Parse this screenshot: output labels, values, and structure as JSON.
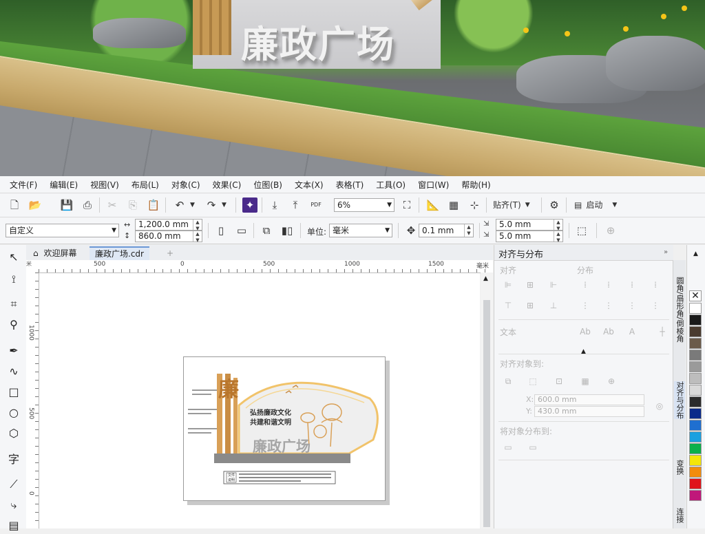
{
  "scene": {
    "sign_text": "廉政广场"
  },
  "menu": [
    "文件(F)",
    "编辑(E)",
    "视图(V)",
    "布局(L)",
    "对象(C)",
    "效果(C)",
    "位图(B)",
    "文本(X)",
    "表格(T)",
    "工具(O)",
    "窗口(W)",
    "帮助(H)"
  ],
  "toolbar": {
    "zoom": "6%",
    "snap_label": "贴齐(T)",
    "launch_label": "启动",
    "pdf_label": "PDF"
  },
  "props": {
    "paper_preset": "自定义",
    "width": "1,200.0 mm",
    "height": "860.0 mm",
    "units_label": "单位:",
    "units_value": "毫米",
    "nudge": "0.1 mm",
    "dup_x": "5.0 mm",
    "dup_y": "5.0 mm"
  },
  "tabs": [
    {
      "label": "欢迎屏幕"
    },
    {
      "label": "廉政广场.cdr"
    }
  ],
  "ruler": {
    "h_ticks": [
      "500",
      "0",
      "500",
      "1000",
      "1500"
    ],
    "h_unit": "毫米",
    "v_ticks": [
      "1000",
      "500",
      "0"
    ],
    "corner_unit": "米"
  },
  "design": {
    "big_char": "廉",
    "slogan1": "弘扬廉政文化",
    "slogan2": "共建和谐文明",
    "bottom_title": "廉政广场",
    "caption_label1": "文件",
    "caption_label2": "说明"
  },
  "docker": {
    "title": "对齐与分布",
    "align": "对齐",
    "distribute": "分布",
    "text": "文本",
    "align_to": "对齐对象到:",
    "x": "600.0 mm",
    "y": "430.0 mm",
    "distribute_to": "将对象分布到:"
  },
  "side_tabs": [
    "圆角/扇形角/倒棱角",
    "对齐与分布",
    "变换",
    "连接"
  ],
  "palette": [
    "#ffffff",
    "#1a1a1a",
    "#4a3b2f",
    "#6b5b4a",
    "#7a7a7a",
    "#9a9a9a",
    "#bdbdbd",
    "#d9d9d9",
    "#2b2b2b",
    "#0a2a8a",
    "#1f6fd0",
    "#1aa0e0",
    "#0bb04a",
    "#f4e60a",
    "#f28c0c",
    "#e0141a",
    "#c0187a"
  ]
}
